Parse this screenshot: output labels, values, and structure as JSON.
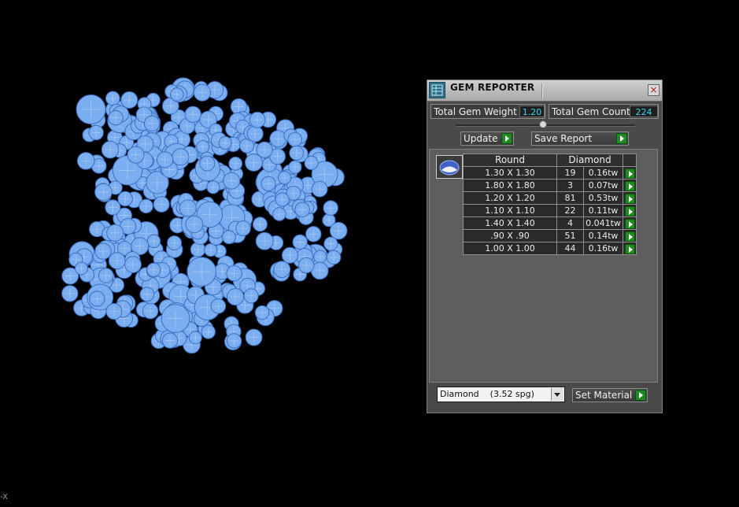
{
  "panel": {
    "title": "GEM REPORTER",
    "close_icon": "×",
    "total_weight_label": "Total Gem Weight",
    "total_weight_value": "1.20",
    "total_count_label": "Total Gem Count",
    "total_count_value": "224",
    "update_label": "Update",
    "save_report_label": "Save Report",
    "table": {
      "headers": [
        "Round",
        "Diamond"
      ],
      "rows": [
        {
          "size": "1.30 X 1.30",
          "count": "19",
          "weight": "0.16tw"
        },
        {
          "size": "1.80 X 1.80",
          "count": "3",
          "weight": "0.07tw"
        },
        {
          "size": "1.20 X 1.20",
          "count": "81",
          "weight": "0.53tw"
        },
        {
          "size": "1.10 X 1.10",
          "count": "22",
          "weight": "0.11tw"
        },
        {
          "size": "1.40 X 1.40",
          "count": "4",
          "weight": "0.041tw"
        },
        {
          "size": ".90 X .90",
          "count": "51",
          "weight": "0.14tw"
        },
        {
          "size": "1.00 X 1.00",
          "count": "44",
          "weight": "0.16tw"
        }
      ]
    },
    "material_select_value": "Diamond    (3.52 spg)",
    "set_material_label": "Set Material"
  },
  "viewport": {
    "axis_label": "-X",
    "gem_color": "#7aaef0"
  },
  "colors": {
    "panel_bg": "#4a4a4a",
    "value_text": "#33d6f0",
    "play_button": "#1f8a22"
  }
}
